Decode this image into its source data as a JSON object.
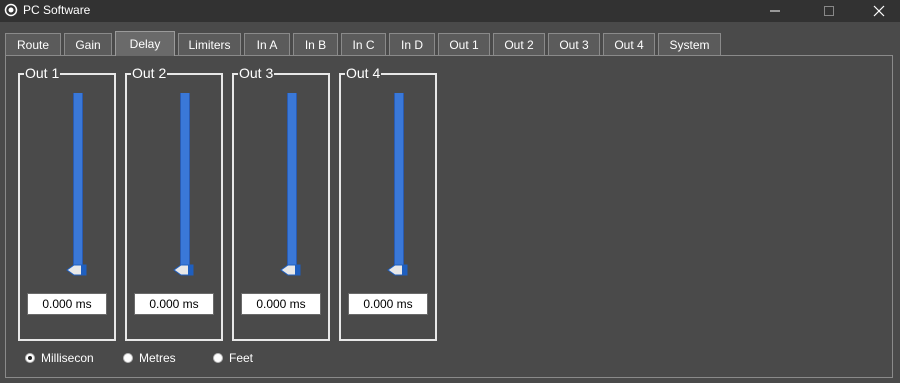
{
  "window": {
    "title": "PC Software",
    "icon": "app-gear-icon",
    "controls": [
      "minimize-icon",
      "maximize-icon",
      "close-icon"
    ]
  },
  "tabs": [
    {
      "label": "Route",
      "active": false
    },
    {
      "label": "Gain",
      "active": false
    },
    {
      "label": "Delay",
      "active": true
    },
    {
      "label": "Limiters",
      "active": false
    },
    {
      "label": "In A",
      "active": false
    },
    {
      "label": "In B",
      "active": false
    },
    {
      "label": "In C",
      "active": false
    },
    {
      "label": "In D",
      "active": false
    },
    {
      "label": "Out 1",
      "active": false
    },
    {
      "label": "Out 2",
      "active": false
    },
    {
      "label": "Out 3",
      "active": false
    },
    {
      "label": "Out 4",
      "active": false
    },
    {
      "label": "System",
      "active": false
    }
  ],
  "outputs": [
    {
      "title": "Out 1",
      "value": "0.000 ms",
      "slider_level": 0
    },
    {
      "title": "Out 2",
      "value": "0.000 ms",
      "slider_level": 0
    },
    {
      "title": "Out 3",
      "value": "0.000 ms",
      "slider_level": 0
    },
    {
      "title": "Out 4",
      "value": "0.000 ms",
      "slider_level": 0
    }
  ],
  "units": {
    "options": [
      {
        "label": "Millisecon",
        "selected": true
      },
      {
        "label": "Metres",
        "selected": false
      },
      {
        "label": "Feet",
        "selected": false
      }
    ]
  },
  "colors": {
    "background": "#4a4a4a",
    "titlebar": "#323232",
    "slider": "#3a78d8"
  }
}
